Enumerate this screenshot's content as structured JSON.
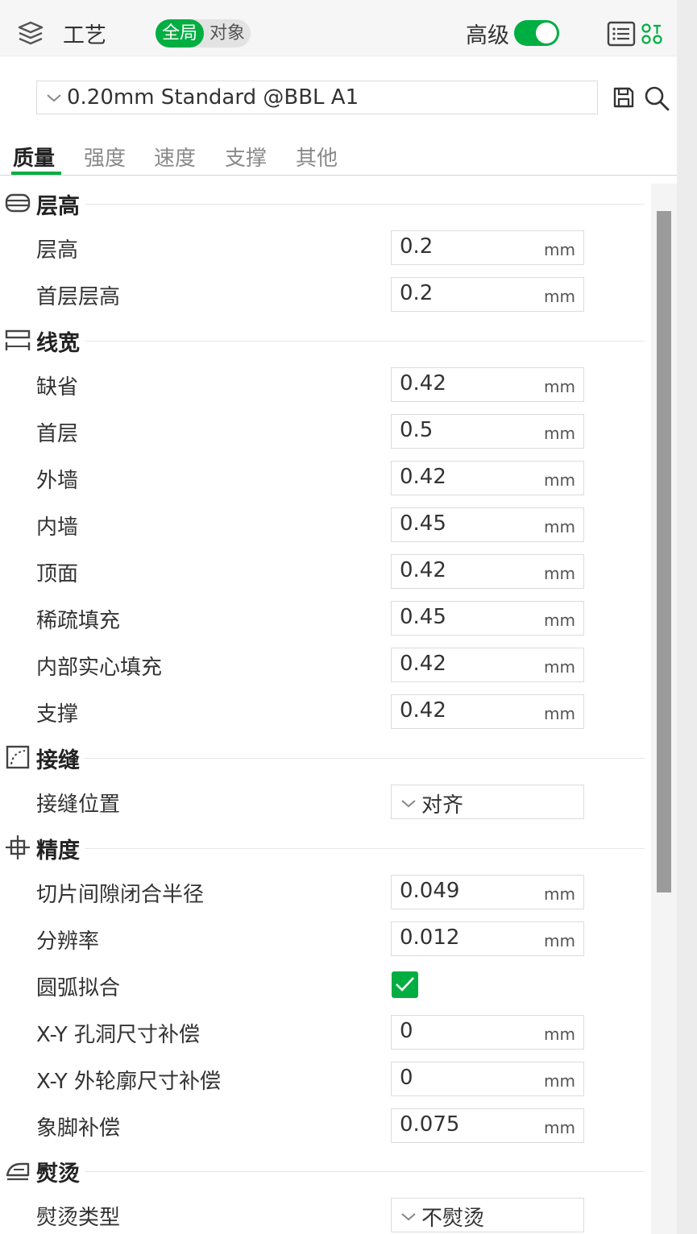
{
  "header": {
    "title": "工艺",
    "mode_global": "全局",
    "mode_object": "对象",
    "advanced_label": "高级",
    "advanced_on": true
  },
  "preset": {
    "value": "0.20mm Standard @BBL A1"
  },
  "tabs": [
    {
      "label": "质量",
      "active": true
    },
    {
      "label": "强度",
      "active": false
    },
    {
      "label": "速度",
      "active": false
    },
    {
      "label": "支撑",
      "active": false
    },
    {
      "label": "其他",
      "active": false
    }
  ],
  "icons": {
    "layers": "layers-icon",
    "list": "list-icon",
    "compare": "compare-icon",
    "save": "save-icon",
    "search": "search-icon",
    "chevron": "chevron-down-icon"
  },
  "colors": {
    "accent": "#00ae42",
    "scroll_thumb": "#9b9b9b"
  },
  "sections": {
    "layer_height": {
      "title": "层高",
      "rows": [
        {
          "label": "层高",
          "value": "0.2",
          "unit": "mm"
        },
        {
          "label": "首层层高",
          "value": "0.2",
          "unit": "mm"
        }
      ]
    },
    "line_width": {
      "title": "线宽",
      "rows": [
        {
          "label": "缺省",
          "value": "0.42",
          "unit": "mm"
        },
        {
          "label": "首层",
          "value": "0.5",
          "unit": "mm"
        },
        {
          "label": "外墙",
          "value": "0.42",
          "unit": "mm"
        },
        {
          "label": "内墙",
          "value": "0.45",
          "unit": "mm"
        },
        {
          "label": "顶面",
          "value": "0.42",
          "unit": "mm"
        },
        {
          "label": "稀疏填充",
          "value": "0.45",
          "unit": "mm"
        },
        {
          "label": "内部实心填充",
          "value": "0.42",
          "unit": "mm"
        },
        {
          "label": "支撑",
          "value": "0.42",
          "unit": "mm"
        }
      ]
    },
    "seam": {
      "title": "接缝",
      "rows": [
        {
          "label": "接缝位置",
          "value": "对齐"
        }
      ]
    },
    "precision": {
      "title": "精度",
      "rows": [
        {
          "label": "切片间隙闭合半径",
          "value": "0.049",
          "unit": "mm"
        },
        {
          "label": "分辨率",
          "value": "0.012",
          "unit": "mm"
        },
        {
          "label": "圆弧拟合",
          "checked": true
        },
        {
          "label": "X-Y 孔洞尺寸补偿",
          "value": "0",
          "unit": "mm"
        },
        {
          "label": "X-Y 外轮廓尺寸补偿",
          "value": "0",
          "unit": "mm"
        },
        {
          "label": "象脚补偿",
          "value": "0.075",
          "unit": "mm"
        }
      ]
    },
    "ironing": {
      "title": "熨烫",
      "rows": [
        {
          "label": "熨烫类型",
          "value": "不熨烫"
        }
      ]
    }
  }
}
